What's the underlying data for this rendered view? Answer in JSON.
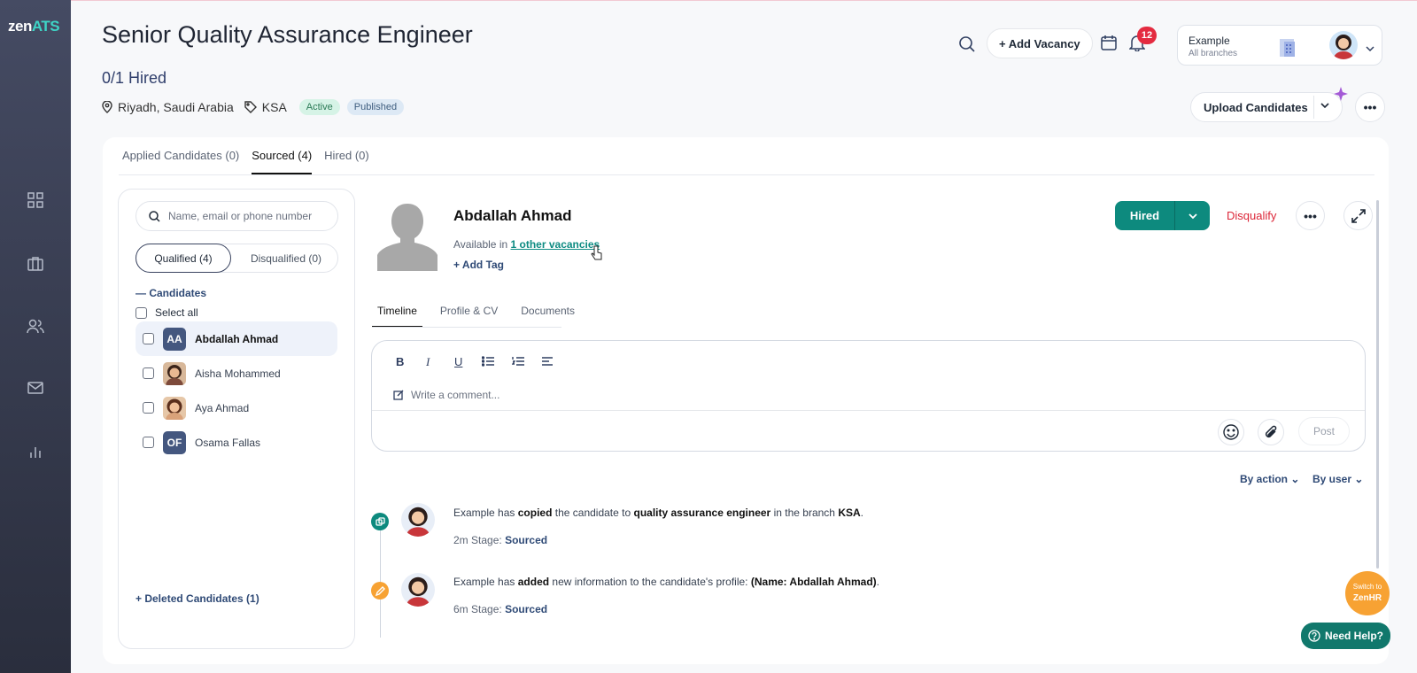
{
  "app": {
    "logo_main": "zen",
    "logo_accent": "ATS"
  },
  "job": {
    "title": "Senior Quality Assurance Engineer",
    "hired_count": "0/1 Hired",
    "location": "Riyadh, Saudi Arabia",
    "branch_tag": "KSA",
    "status": "Active",
    "visibility": "Published"
  },
  "header": {
    "add_vacancy": "+ Add Vacancy",
    "notification_count": "12",
    "account_name": "Example",
    "account_sub": "All branches",
    "upload_candidates": "Upload Candidates"
  },
  "tabs": [
    {
      "label": "Applied Candidates (0)"
    },
    {
      "label": "Sourced (4)"
    },
    {
      "label": "Hired (0)"
    }
  ],
  "left_panel": {
    "search_placeholder": "Name, email or phone number",
    "qualified": "Qualified (4)",
    "disqualified": "Disqualified (0)",
    "candidates_heading": "Candidates",
    "select_all": "Select all",
    "candidates": [
      {
        "name": "Abdallah Ahmad",
        "initials": "AA"
      },
      {
        "name": "Aisha Mohammed",
        "initials": ""
      },
      {
        "name": "Aya Ahmad",
        "initials": ""
      },
      {
        "name": "Osama Fallas",
        "initials": "OF"
      }
    ],
    "deleted": "Deleted Candidates (1)"
  },
  "candidate": {
    "name": "Abdallah Ahmad",
    "available_prefix": "Available in",
    "available_link": "1 other vacancies",
    "add_tag": "Add Tag",
    "hired_btn": "Hired",
    "disqualify": "Disqualify"
  },
  "sub_tabs": [
    {
      "label": "Timeline"
    },
    {
      "label": "Profile & CV"
    },
    {
      "label": "Documents"
    }
  ],
  "editor": {
    "placeholder": "Write a comment...",
    "post": "Post",
    "toolbar": {
      "bold": "B",
      "italic": "I",
      "underline": "U"
    }
  },
  "filters": {
    "by_action": "By action",
    "by_user": "By user"
  },
  "timeline": [
    {
      "actor": "Example",
      "verb_pre": "has",
      "verb": "copied",
      "mid": "the candidate to",
      "target": "quality assurance engineer",
      "post": "in the branch",
      "branch": "KSA",
      "time": "2m",
      "stage_label": "Stage:",
      "stage": "Sourced"
    },
    {
      "actor": "Example",
      "verb_pre": "has",
      "verb": "added",
      "mid": "new information to the candidate's profile:",
      "target": "(Name: Abdallah Ahmad)",
      "time": "6m",
      "stage_label": "Stage:",
      "stage": "Sourced"
    }
  ],
  "floating": {
    "switch_line1": "Switch to",
    "switch_line2": "ZenHR",
    "help": "Need Help?"
  },
  "colors": {
    "accent": "#0d8a7e",
    "danger": "#dc2638",
    "sidebar": "#3a3f52"
  }
}
